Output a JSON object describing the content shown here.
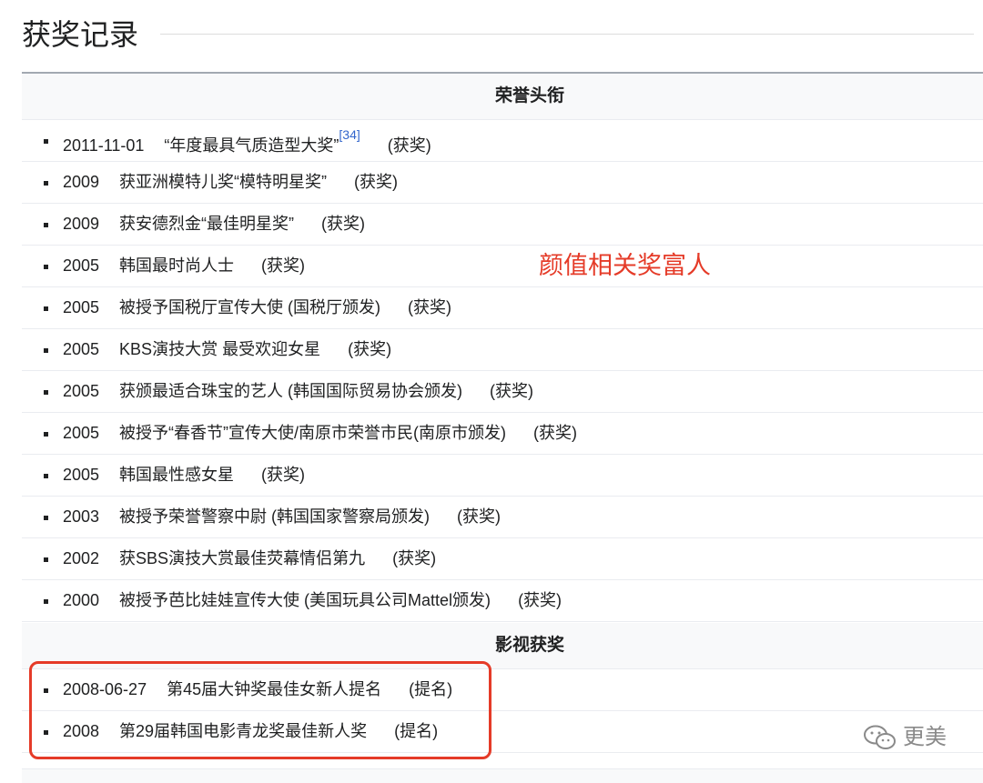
{
  "heading": "获奖记录",
  "sections": [
    {
      "title": "荣誉头衔",
      "items": [
        {
          "date": "2011-11-01",
          "text": "“年度最具气质造型大奖”",
          "ref": "[34]",
          "status": "(获奖)"
        },
        {
          "date": "2009",
          "text": "获亚洲模特儿奖“模特明星奖”",
          "status": "(获奖)"
        },
        {
          "date": "2009",
          "text": "获安德烈金“最佳明星奖”",
          "status": "(获奖)"
        },
        {
          "date": "2005",
          "text": "韩国最时尚人士",
          "status": "(获奖)"
        },
        {
          "date": "2005",
          "text": "被授予国税厅宣传大使 (国税厅颁发)",
          "status": "(获奖)"
        },
        {
          "date": "2005",
          "text": "KBS演技大赏 最受欢迎女星",
          "status": "(获奖)"
        },
        {
          "date": "2005",
          "text": "获颁最适合珠宝的艺人 (韩国国际贸易协会颁发)",
          "status": "(获奖)"
        },
        {
          "date": "2005",
          "text": "被授予“春香节”宣传大使/南原市荣誉市民(南原市颁发)",
          "status": "(获奖)"
        },
        {
          "date": "2005",
          "text": "韩国最性感女星",
          "status": "(获奖)"
        },
        {
          "date": "2003",
          "text": "被授予荣誉警察中尉 (韩国国家警察局颁发)",
          "status": "(获奖)"
        },
        {
          "date": "2002",
          "text": "获SBS演技大赏最佳荧幕情侣第九",
          "status": "(获奖)"
        },
        {
          "date": "2000",
          "text": "被授予芭比娃娃宣传大使 (美国玩具公司Mattel颁发)",
          "status": "(获奖)"
        }
      ]
    },
    {
      "title": "影视获奖",
      "items": [
        {
          "date": "2008-06-27",
          "text": "第45届大钟奖最佳女新人提名",
          "status": "(提名)"
        },
        {
          "date": "2008",
          "text": "第29届韩国电影青龙奖最佳新人奖",
          "status": "(提名)"
        }
      ]
    }
  ],
  "annotation": "颜值相关奖富人",
  "watermark": "更美",
  "colors": {
    "annotation": "#e53b28",
    "link": "#3366cc",
    "border": "#a2a9b1"
  }
}
